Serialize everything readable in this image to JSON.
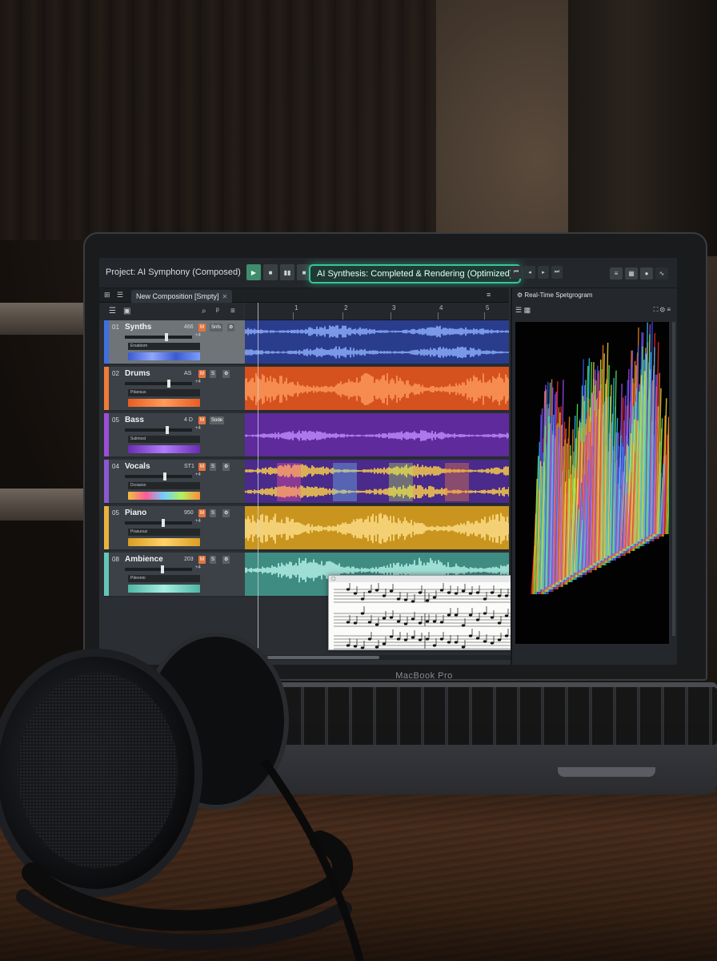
{
  "project": {
    "title": "Project: AI Symphony (Composed)",
    "status": "AI Synthesis: Completed & Rendering (Optimized)"
  },
  "transport": {
    "play_icon": "▶",
    "stop_icon": "■",
    "record_icon": "●"
  },
  "tabs": {
    "active": "New Composition [Smpty]"
  },
  "ruler": {
    "marks": [
      "1",
      "2",
      "3",
      "4",
      "5"
    ]
  },
  "tracks": [
    {
      "num": "01",
      "name": "Synths",
      "value": "466",
      "badge": "Snfs",
      "fader_db": "+4",
      "preset": "Ersabiom",
      "color": "#3f6fe0",
      "fader": 0.62
    },
    {
      "num": "02",
      "name": "Drums",
      "value": "AS",
      "badge": "",
      "fader_db": "+4",
      "preset": "Pdansus",
      "color": "#f07a3a",
      "fader": 0.66
    },
    {
      "num": "05",
      "name": "Bass",
      "value": "4 D",
      "badge": "Sode",
      "fader_db": "+4",
      "preset": "Sulimost",
      "color": "#9a4fd8",
      "fader": 0.64
    },
    {
      "num": "04",
      "name": "Vocals",
      "value": "ST1",
      "badge": "",
      "fader_db": "+4",
      "preset": "Dcoasso",
      "color": "#8c58d2",
      "fader": 0.6
    },
    {
      "num": "05",
      "name": "Piano",
      "value": "950",
      "badge": "",
      "fader_db": "+4",
      "preset": "Prasuous",
      "color": "#e8b43c",
      "fader": 0.58
    },
    {
      "num": "08",
      "name": "Ambience",
      "value": "203",
      "badge": "",
      "fader_db": "+4",
      "preset": "Pdeonto",
      "color": "#63c7b8",
      "fader": 0.56
    }
  ],
  "spectrogram": {
    "tab_label": "Real-Time Spetgrogram"
  },
  "laptop": {
    "brand": "MacBook Pro"
  },
  "colors": {
    "accent": "#37c59a",
    "synths": "#4f84e8",
    "drums": "#e9692f",
    "bass": "#8f46d6",
    "piano": "#e6b23a",
    "ambience": "#76d2c3"
  }
}
